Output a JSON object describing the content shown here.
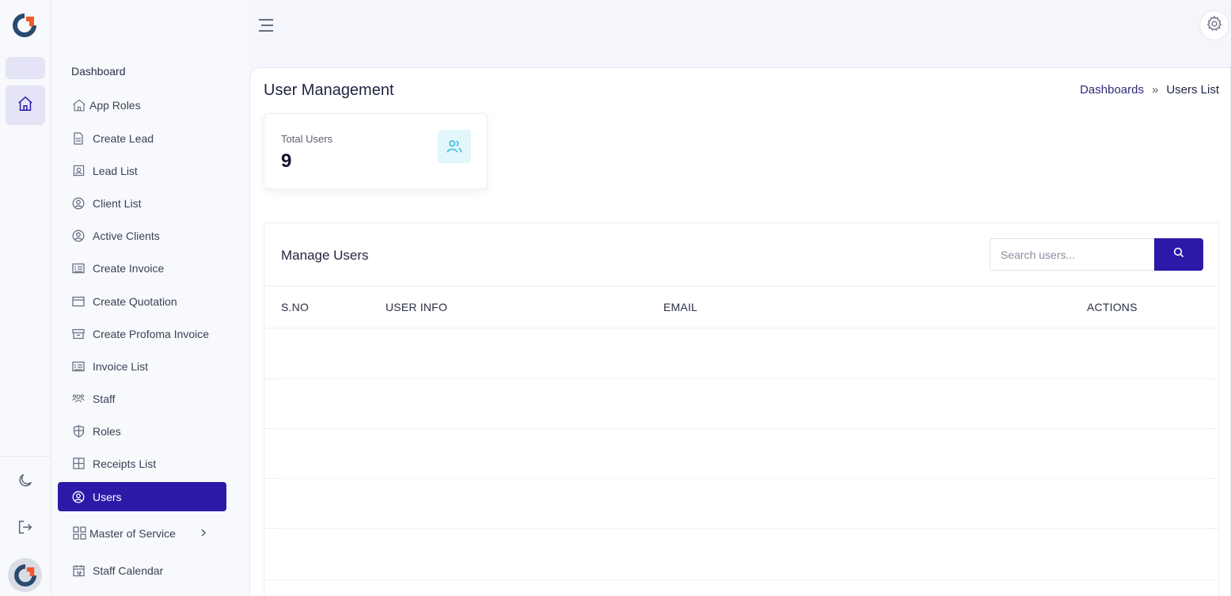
{
  "icons": {
    "logo": "app-logo",
    "home": "home-icon",
    "theme": "moon-icon",
    "logout": "logout-icon",
    "menu": "hamburger-icon",
    "settings": "gear-icon",
    "search": "search-icon",
    "users": "users-icon"
  },
  "colors": {
    "accent": "#2b1aa8",
    "logo_orange": "#f05a28",
    "logo_blue": "#2a4a6e",
    "stat_icon_bg": "#e2f6fb",
    "stat_icon": "#2bb8d8"
  },
  "sidebar": {
    "header": "Dashboard",
    "items": [
      {
        "label": "App Roles",
        "icon": "home-icon"
      },
      {
        "label": "Create Lead",
        "icon": "document-icon"
      },
      {
        "label": "Lead List",
        "icon": "contact-card-icon"
      },
      {
        "label": "Client List",
        "icon": "user-circle-icon"
      },
      {
        "label": "Active Clients",
        "icon": "user-circle-icon"
      },
      {
        "label": "Create Invoice",
        "icon": "receipt-icon"
      },
      {
        "label": "Create Quotation",
        "icon": "window-icon"
      },
      {
        "label": "Create Profoma Invoice",
        "icon": "archive-icon"
      },
      {
        "label": "Invoice List",
        "icon": "receipt-icon"
      },
      {
        "label": "Staff",
        "icon": "people-icon"
      },
      {
        "label": "Roles",
        "icon": "shield-icon"
      },
      {
        "label": "Receipts List",
        "icon": "grid-icon"
      },
      {
        "label": "Users",
        "icon": "user-circle-icon",
        "active": true
      },
      {
        "label": "Master of Service",
        "icon": "apps-icon",
        "has_submenu": true
      },
      {
        "label": "Staff Calendar",
        "icon": "calendar-icon"
      }
    ]
  },
  "header": {
    "title": "User Management",
    "breadcrumb": {
      "parent": "Dashboards",
      "separator": "»",
      "current": "Users List"
    }
  },
  "stats": {
    "total_users_label": "Total Users",
    "total_users_value": "9"
  },
  "users_panel": {
    "title": "Manage Users",
    "search_placeholder": "Search users...",
    "columns": [
      "S.NO",
      "USER INFO",
      "EMAIL",
      "ACTIONS"
    ],
    "rows": []
  }
}
